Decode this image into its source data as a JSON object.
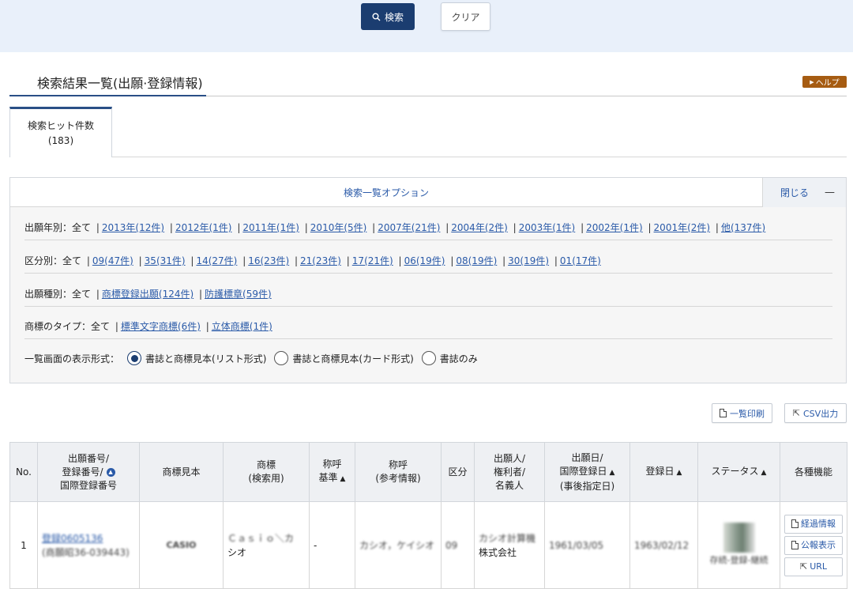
{
  "top": {
    "search_label": "検索",
    "clear_label": "クリア"
  },
  "page_title": "検索結果一覧(出願·登録情報)",
  "help_label": "ヘルプ",
  "tab": {
    "label": "検索ヒット件数",
    "count": "(183)"
  },
  "options": {
    "title": "検索一覧オプション",
    "close_label": "閉じる",
    "close_symbol": "—",
    "year": {
      "label": "出願年別：全て",
      "links": [
        "2013年(12件)",
        "2012年(1件)",
        "2011年(1件)",
        "2010年(5件)",
        "2007年(21件)",
        "2004年(2件)",
        "2003年(1件)",
        "2002年(1件)",
        "2001年(2件)",
        "他(137件)"
      ]
    },
    "class": {
      "label": "区分別：全て",
      "links": [
        "09(47件)",
        "35(31件)",
        "14(27件)",
        "16(23件)",
        "21(23件)",
        "17(21件)",
        "06(19件)",
        "08(19件)",
        "30(19件)",
        "01(17件)"
      ]
    },
    "app_type": {
      "label": "出願種別：全て",
      "links": [
        "商標登録出願(124件)",
        "防護標章(59件)"
      ]
    },
    "mark_type": {
      "label": "商標のタイプ：全て",
      "links": [
        "標準文字商標(6件)",
        "立体商標(1件)"
      ]
    },
    "display": {
      "label": "一覧画面の表示形式：",
      "opt1": "書誌と商標見本(リスト形式)",
      "opt2": "書誌と商標見本(カード形式)",
      "opt3": "書誌のみ"
    }
  },
  "actions": {
    "print_label": "一覧印刷",
    "csv_label": "CSV出力"
  },
  "table": {
    "h_no": "No.",
    "h_num1": "出願番号/",
    "h_num2": "登録番号/",
    "h_num3": "国際登録番号",
    "h_sample": "商標見本",
    "h_mark1": "商標",
    "h_mark2": "(検索用)",
    "h_call1": "称呼",
    "h_call2": "基準",
    "h_ref1": "称呼",
    "h_ref2": "(参考情報)",
    "h_class": "区分",
    "h_app1": "出願人/",
    "h_app2": "権利者/",
    "h_app3": "名義人",
    "h_date1": "出願日/",
    "h_date2": "国際登録日",
    "h_date3": "(事後指定日)",
    "h_reg": "登録日",
    "h_status": "ステータス",
    "h_func": "各種機能",
    "row": {
      "no": "1",
      "num_link": "登録0605136",
      "num_sub": "(商願昭36-039443)",
      "sample_text": "CASIO",
      "mark1": "Ｃａｓｉｏ＼カ",
      "mark2": "シオ",
      "call": "-",
      "ref": "カシオ，ケイシオ",
      "class": "09",
      "applicant1": "カシオ計算機",
      "applicant2": "株式会社",
      "app_date": "1961/03/05",
      "reg_date": "1963/02/12",
      "status_text": "存続-登録-継続",
      "btn1": "経過情報",
      "btn2": "公報表示",
      "btn3": "URL"
    }
  }
}
